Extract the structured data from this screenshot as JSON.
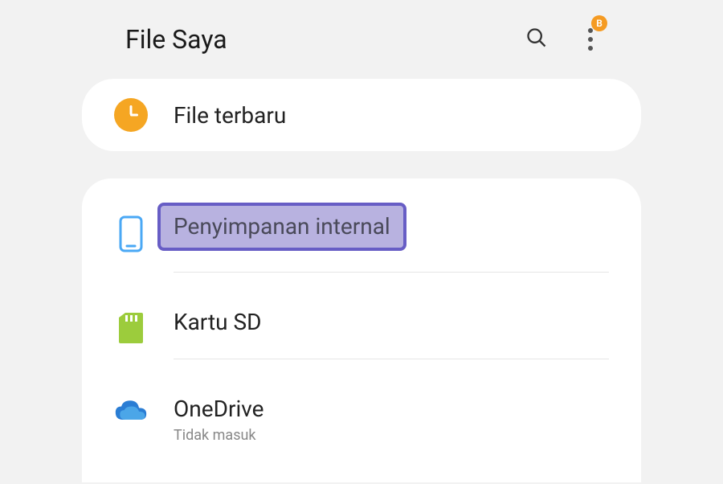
{
  "header": {
    "title": "File Saya",
    "badge": "B"
  },
  "recent": {
    "label": "File terbaru"
  },
  "storage": {
    "items": [
      {
        "label": "Penyimpanan internal",
        "sublabel": null,
        "highlighted": true
      },
      {
        "label": "Kartu SD",
        "sublabel": null,
        "highlighted": false
      },
      {
        "label": "OneDrive",
        "sublabel": "Tidak masuk",
        "highlighted": false
      }
    ]
  }
}
